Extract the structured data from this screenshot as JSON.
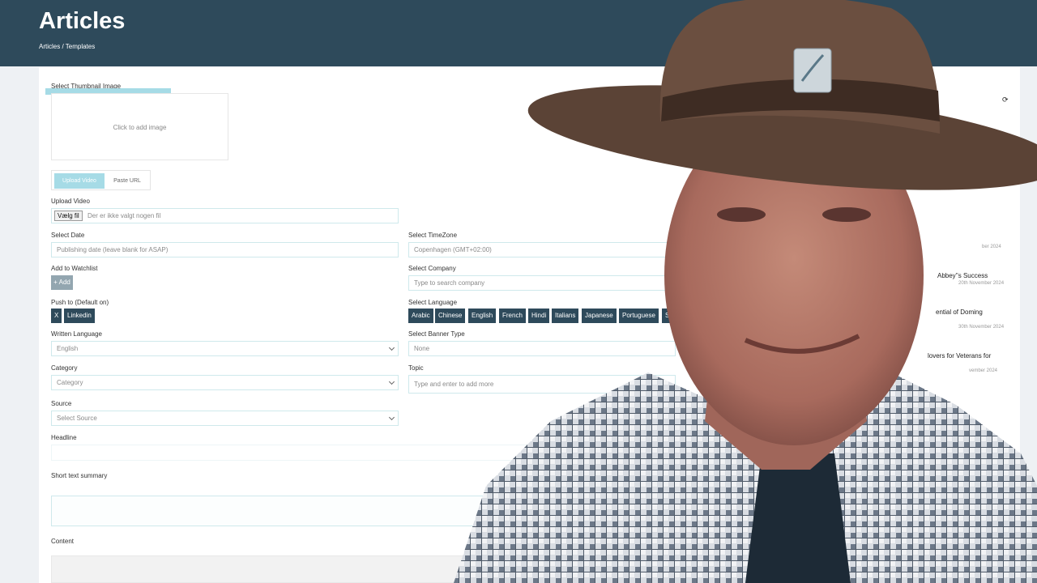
{
  "header": {
    "title": "Articles",
    "breadcrumb": "Articles / Templates"
  },
  "thumbnail": {
    "label": "Select Thumbnail Image",
    "placeholder": "Click to add image"
  },
  "video_tabs": {
    "upload": "Upload Video",
    "paste": "Paste URL"
  },
  "upload_video": {
    "label": "Upload Video",
    "button": "Vælg fil",
    "status": "Der er ikke valgt nogen fil"
  },
  "select_date": {
    "label": "Select Date",
    "placeholder": "Publishing date (leave blank for ASAP)"
  },
  "timezone": {
    "label": "Select TimeZone",
    "value": "Copenhagen (GMT+02:00)"
  },
  "watchlist": {
    "label": "Add to Watchlist",
    "button": "+ Add"
  },
  "company": {
    "label": "Select Company",
    "placeholder": "Type to search company"
  },
  "push": {
    "label": "Push to (Default on)",
    "options": [
      "X",
      "Linkedin"
    ]
  },
  "language": {
    "label": "Select Language",
    "options": [
      "Arabic",
      "Chinese",
      "English",
      "French",
      "Hindi",
      "Italians",
      "Japanese",
      "Portuguese",
      "Spa"
    ]
  },
  "written_language": {
    "label": "Written Language",
    "value": "English"
  },
  "banner_type": {
    "label": "Select Banner Type",
    "value": "None"
  },
  "category": {
    "label": "Category",
    "value": "Category"
  },
  "topic": {
    "label": "Topic",
    "placeholder": "Type and enter to add more"
  },
  "source": {
    "label": "Source",
    "value": "Select Source"
  },
  "headline": {
    "label": "Headline"
  },
  "summary": {
    "label": "Short text summary"
  },
  "content": {
    "label": "Content"
  },
  "feed": {
    "refresh_icon": "refresh-icon",
    "items": [
      {
        "title": "",
        "date": "ber 2024"
      },
      {
        "title": "Abbey''s Success",
        "date": "20th November 2024"
      },
      {
        "title": "ential of Doming",
        "date": "30th November 2024"
      },
      {
        "title": "lovers for Veterans for",
        "date": "vember 2024"
      }
    ]
  },
  "colors": {
    "header_bg": "#2e4a5b",
    "accent": "#a6dbe6",
    "chip_bg": "#2e4a5b"
  }
}
